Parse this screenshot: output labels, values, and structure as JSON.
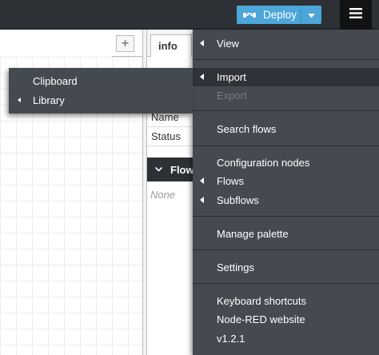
{
  "header": {
    "deploy_label": "Deploy",
    "icons": {
      "deploy": "deploy-icon",
      "caret": "caret-down-icon",
      "menu": "hamburger-menu-icon"
    },
    "colors": {
      "background": "#2d3136",
      "deploy_button": "#4da6d8",
      "menu_button": "#111315"
    }
  },
  "workspace": {
    "add_tab_label": "+"
  },
  "sidebar": {
    "tab_label": "info",
    "rows": {
      "name_label": "Name",
      "status_label": "Status"
    },
    "section_title": "Flow",
    "none_text": "None"
  },
  "main_menu": {
    "background": "#454a51",
    "items": {
      "view": "View",
      "import": "Import",
      "export": "Export",
      "search_flows": "Search flows",
      "configuration_nodes": "Configuration nodes",
      "flows": "Flows",
      "subflows": "Subflows",
      "manage_palette": "Manage palette",
      "settings": "Settings",
      "keyboard_shortcuts": "Keyboard shortcuts",
      "website": "Node-RED website",
      "version": "v1.2.1"
    },
    "active_item": "Import",
    "disabled_item": "Export"
  },
  "import_submenu": {
    "items": {
      "clipboard": "Clipboard",
      "library": "Library"
    }
  }
}
